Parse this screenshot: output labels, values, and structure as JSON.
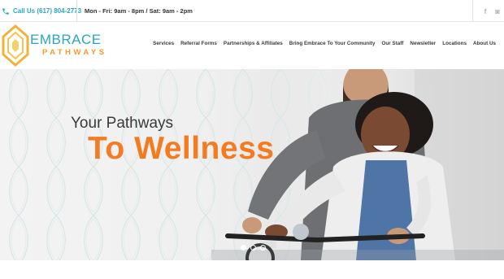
{
  "topbar": {
    "call_label": "Call Us (617) 804-2773",
    "hours": "Mon - Fri: 9am - 8pm / Sat: 9am - 2pm",
    "social": [
      {
        "name": "facebook-icon",
        "glyph": "f"
      },
      {
        "name": "instagram-icon",
        "glyph": "◙"
      }
    ]
  },
  "logo": {
    "line1": "EMBRACE",
    "line2": "PATHWAYS"
  },
  "nav": {
    "items": [
      "Services",
      "Referral Forms",
      "Partnerships & Affiliates",
      "Bring Embrace To Your Community",
      "Our Staff",
      "Newsletter",
      "Locations",
      "About Us"
    ]
  },
  "hero": {
    "subtitle": "Your Pathways",
    "title": "To Wellness",
    "slides": [
      true,
      false,
      false
    ]
  },
  "colors": {
    "accent_blue": "#2ba5c2",
    "accent_orange": "#f47b20",
    "logo_orange": "#f39c2a"
  }
}
